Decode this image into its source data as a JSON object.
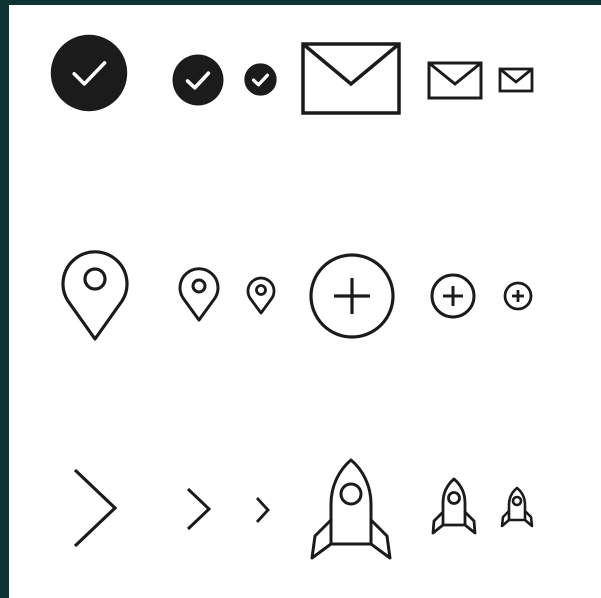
{
  "background_color": "#0e3333",
  "canvas_color": "#ffffff",
  "icon_color": "#1b1b1b",
  "icons": [
    "check-circle-large-icon",
    "check-circle-medium-icon",
    "check-circle-small-icon",
    "envelope-large-icon",
    "envelope-medium-icon",
    "envelope-small-icon",
    "map-pin-large-icon",
    "map-pin-medium-icon",
    "map-pin-small-icon",
    "plus-circle-large-icon",
    "plus-circle-medium-icon",
    "plus-circle-small-icon",
    "chevron-right-large-icon",
    "chevron-right-medium-icon",
    "chevron-right-small-icon",
    "rocket-large-icon",
    "rocket-medium-icon",
    "rocket-small-icon"
  ]
}
